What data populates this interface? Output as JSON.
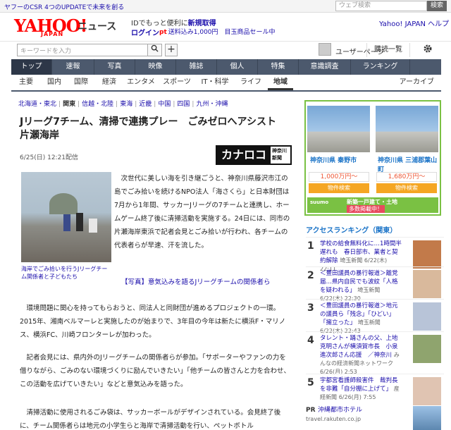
{
  "topbar": {
    "csr_link": "ヤフーのCSR 4つのUPDATEで未来を創る",
    "web_search_placeholder": "ウェブ検索",
    "search_button": "検索"
  },
  "header": {
    "logo": "YAHOO!",
    "logo_sub": "JAPAN",
    "service": "ニュース",
    "promo_line1": "IDでもっと便利に",
    "promo_line1_link": "新規取得",
    "login": "ログイン",
    "promo_line2_badge": "pt",
    "promo_line2": "送料込み1,000円　目玉商品セール中",
    "right_links": "Yahoo! JAPAN  ヘルプ"
  },
  "searchbar": {
    "placeholder": "キーワードを入力",
    "search_icon": "search-icon",
    "plus": "+",
    "user_page": "ユーザーページ",
    "subscriptions": "購読一覧",
    "settings_icon": "gear-icon"
  },
  "global_nav": [
    {
      "label": "トップ",
      "active": true
    },
    {
      "label": "速報"
    },
    {
      "label": "写真"
    },
    {
      "label": "映像"
    },
    {
      "label": "雑誌"
    },
    {
      "label": "個人"
    },
    {
      "label": "特集"
    },
    {
      "label": "意識調査"
    },
    {
      "label": "ランキング"
    }
  ],
  "sub_nav": [
    {
      "label": "主要"
    },
    {
      "label": "国内"
    },
    {
      "label": "国際"
    },
    {
      "label": "経済"
    },
    {
      "label": "エンタメ"
    },
    {
      "label": "スポーツ"
    },
    {
      "label": "IT・科学"
    },
    {
      "label": "ライフ"
    },
    {
      "label": "地域",
      "active": true
    }
  ],
  "sub_nav_archive": "アーカイブ",
  "region_links": [
    "北海道・東北",
    "関東",
    "信越・北陸",
    "東海",
    "近畿",
    "中国",
    "四国",
    "九州・沖縄"
  ],
  "region_current": "関東",
  "article": {
    "title": "Jリーグ7チーム、清掃で連携プレー　ごみゼロへアシスト　片瀬海岸",
    "date": "6/25(日) 12:21配信",
    "source_logo": "カナロコ",
    "source_sub1": "神奈川",
    "source_sub2": "新聞",
    "photo_caption": "海岸でごみ拾いを行うJリーグチーム関係者と子どもたち",
    "lead": "次世代に美しい海を引き継ごうと、神奈川県藤沢市江の島でごみ拾いを続けるNPO法人「海さくら」と日本財団は7月から1年間、サッカーJリーグの7チームと連携し、ホームゲーム終了後に清掃活動を実施する。24日には、同市の片瀬海岸東浜で記者会見とごみ拾いが行われ、各チームの代表者らが早速、汗を流した。",
    "photo_link": "【写真】意気込みを語るJリーグチームの関係者ら",
    "paragraphs": [
      "環境問題に関心を持ってもらおうと、同法人と同財団が進めるプロジェクトの一環。2015年、湘南ベルマーレと実施したのが始まりで、3年目の今年は新たに横浜F・マリノス、横浜FC、川崎フロンターレが加わった。",
      "記者会見には、県内外のJリーグチームの関係者らが参加。「サポーターやファンの力を借りながら、ごみのない環境づくりに励んでいきたい」「他チームの皆さんと力を合わせ、この活動を広げていきたい」などと意気込みを語った。",
      "清掃活動に使用されるごみ袋は、サッカーボールがデザインされている。会見終了後に、チーム関係者らは地元の小学生らと海岸で清掃活動を行い、ペットボトル"
    ]
  },
  "ad": {
    "item1": {
      "location": "神奈川県 秦野市",
      "price": "1,000万円～",
      "button": "物件検索"
    },
    "item2": {
      "location": "神奈川県 三浦郡葉山町",
      "price": "1,680万円～",
      "button": "物件検索"
    },
    "suumo_logo": "suumo",
    "suumo_line1": "新築一戸建て・土地",
    "suumo_line2": "多数掲載中！"
  },
  "ranking": {
    "title": "アクセスランキング（関東）",
    "items": [
      {
        "num": "1",
        "text": "学校の給食無料化に…1時間半遅れも　春日部市、業者と契約解除",
        "source": "埼玉新聞",
        "time": "6/22(木) 22:11"
      },
      {
        "num": "2",
        "text": "＜豊田議員の暴行報道＞離党届…県内自民でも波紋「人格を疑われる」",
        "source": "埼玉新聞",
        "time": "6/22(木) 22:30"
      },
      {
        "num": "3",
        "text": "＜豊田議員の暴行報道＞地元の議員ら「残念」「ひどい」「擁立った」",
        "source": "埼玉新聞",
        "time": "6/22(木) 22:43"
      },
      {
        "num": "4",
        "text": "タレント・踊さんの父、上地克明さんが横須賀市長　小泉進次郎さん応援　／神奈川",
        "source": "みんなの経済新聞ネットワーク",
        "time": "6/26(月) 2:53"
      },
      {
        "num": "5",
        "text": "宇都宮看護師殺害件　裁判長を非難「自分棚に上げて」",
        "source": "産経新聞",
        "time": "6/26(月) 7:55"
      }
    ]
  },
  "pr": {
    "label": "PR",
    "name": "沖縄都市ホテル",
    "url": "travel.rakuten.co.jp"
  }
}
